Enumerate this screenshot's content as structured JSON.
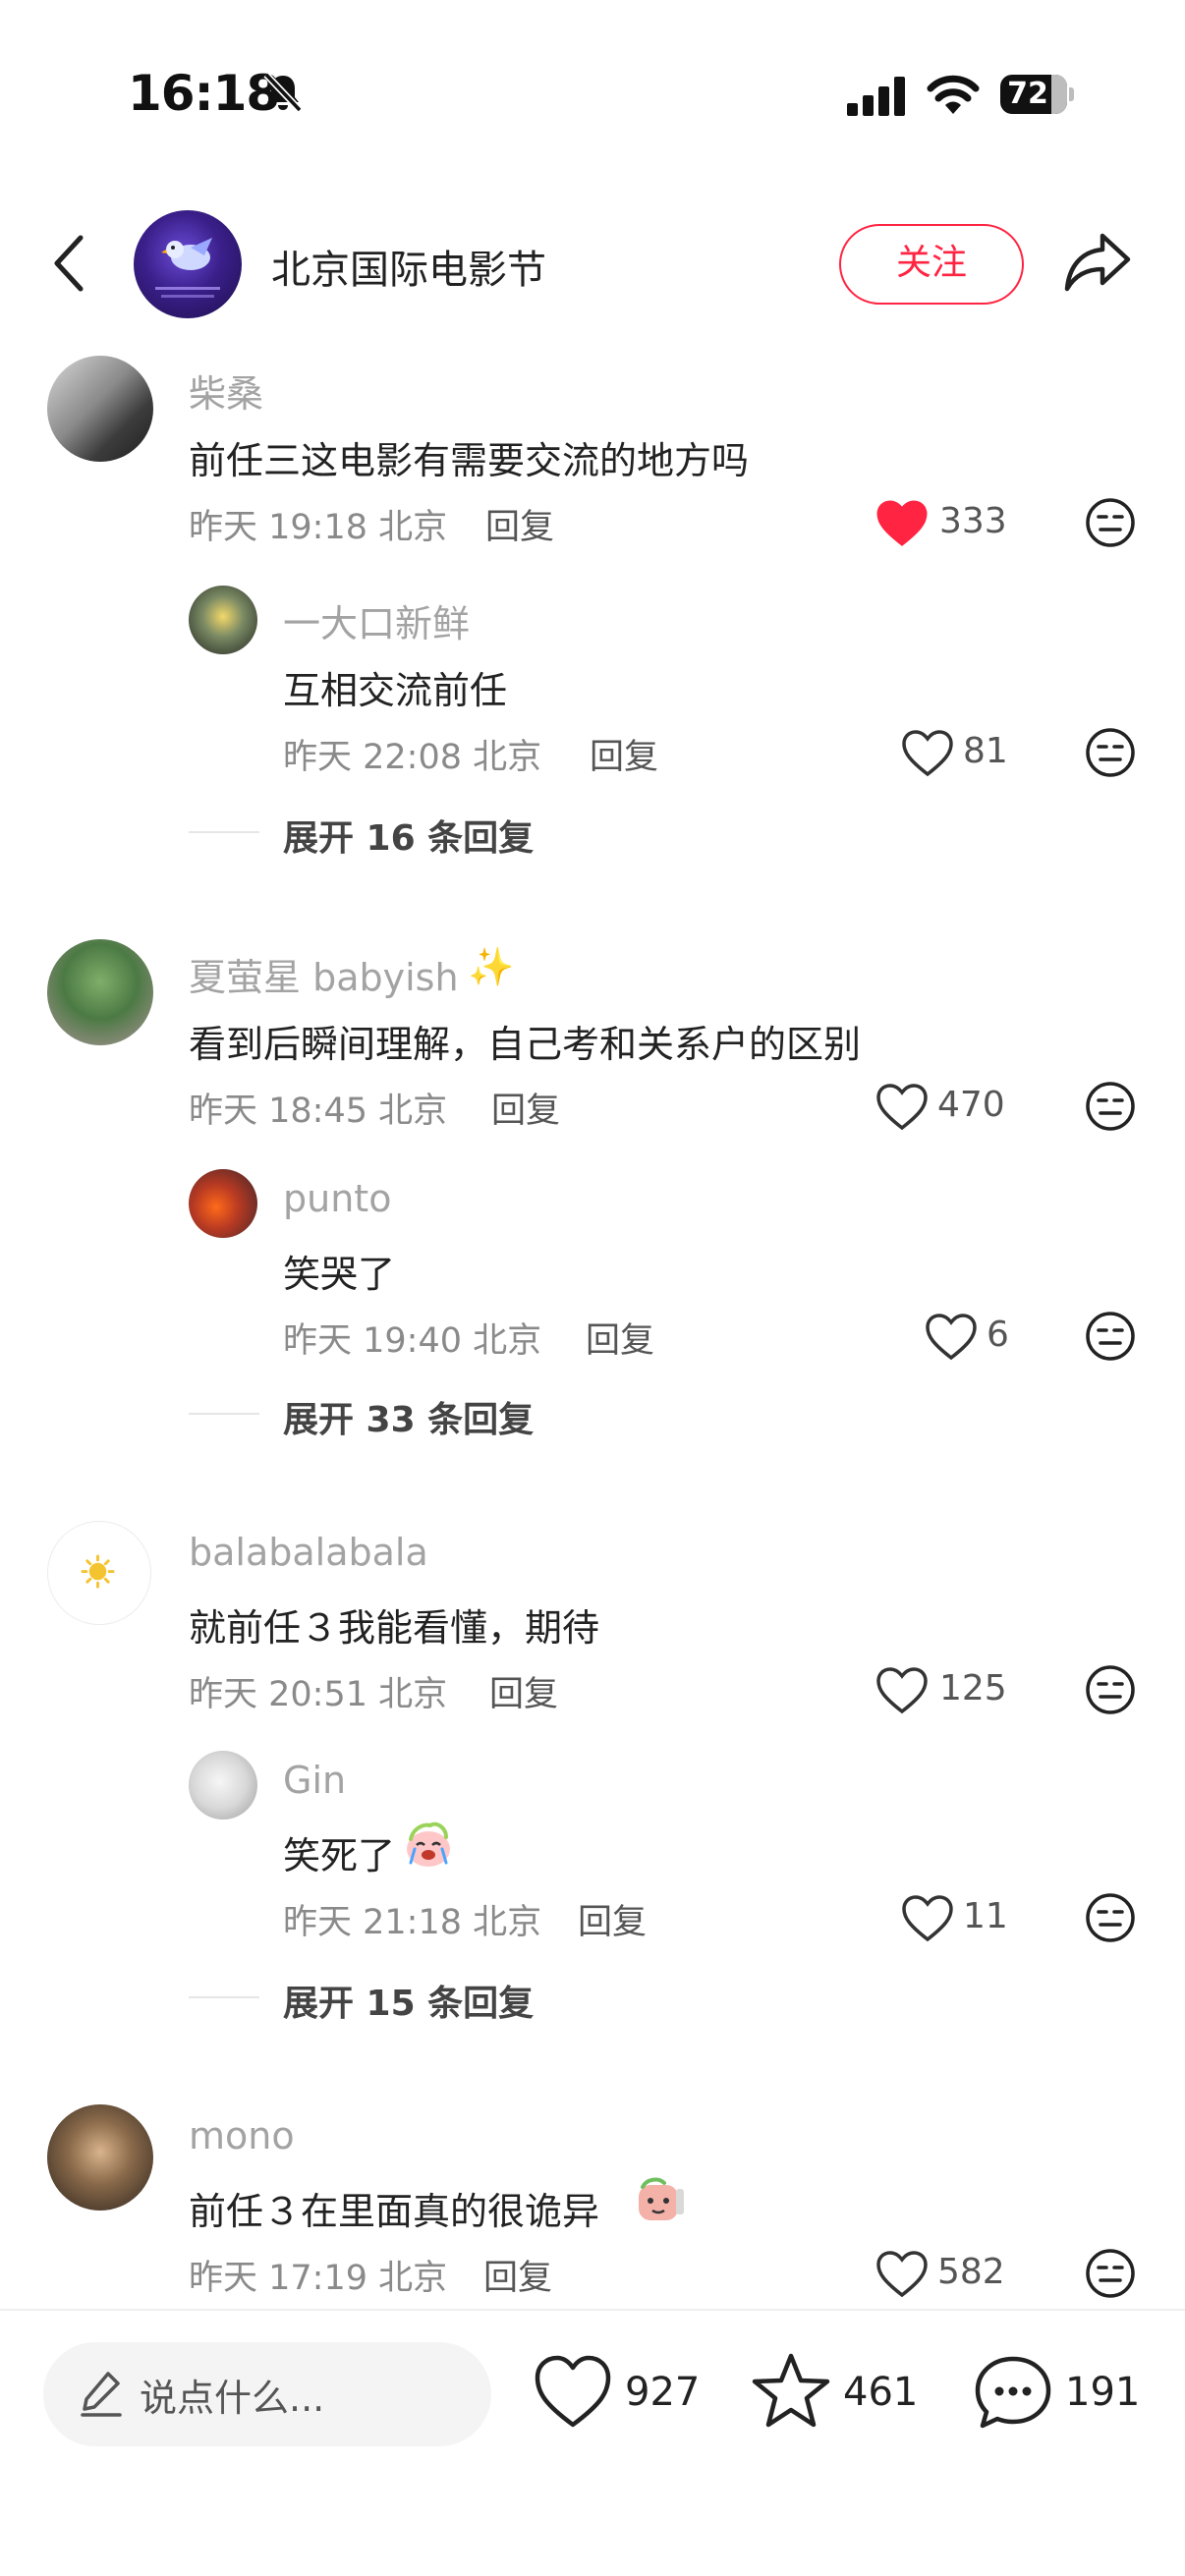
{
  "status_bar": {
    "time": "16:18",
    "battery": "72"
  },
  "header": {
    "account_name": "北京国际电影节",
    "follow_label": "关注"
  },
  "comments": [
    {
      "user": "柴桑",
      "text": "前任三这电影有需要交流的地方吗",
      "time": "昨天 19:18 北京",
      "reply_label": "回复",
      "likes": "333",
      "liked": true,
      "replies": [
        {
          "user": "一大口新鲜",
          "text": "互相交流前任",
          "time": "昨天 22:08 北京",
          "reply_label": "回复",
          "likes": "81"
        }
      ],
      "expand": "展开 16 条回复"
    },
    {
      "user": "夏萤星 babyish",
      "user_emoji": "✨",
      "text": "看到后瞬间理解，自己考和关系户的区别",
      "time": "昨天 18:45 北京",
      "reply_label": "回复",
      "likes": "470",
      "liked": false,
      "replies": [
        {
          "user": "punto",
          "text": "笑哭了",
          "time": "昨天 19:40 北京",
          "reply_label": "回复",
          "likes": "6"
        }
      ],
      "expand": "展开 33 条回复"
    },
    {
      "user": "balabalabala",
      "text": "就前任３我能看懂，期待",
      "time": "昨天 20:51 北京",
      "reply_label": "回复",
      "likes": "125",
      "liked": false,
      "replies": [
        {
          "user": "Gin",
          "text": "笑死了",
          "time": "昨天 21:18 北京",
          "reply_label": "回复",
          "likes": "11"
        }
      ],
      "expand": "展开 15 条回复"
    },
    {
      "user": "mono",
      "text": "前任３在里面真的很诡异",
      "time": "昨天 17:19 北京",
      "reply_label": "回复",
      "likes": "582",
      "liked": false
    }
  ],
  "bottom_bar": {
    "input_placeholder": "说点什么...",
    "like_count": "927",
    "star_count": "461",
    "comment_count": "191"
  },
  "colors": {
    "accent": "#ff2442",
    "like_red": "#ff2442",
    "text": "#222222",
    "muted": "#a3a3a3"
  },
  "icons": [
    "back-icon",
    "share-icon",
    "heart-icon",
    "neutral-face-icon",
    "pencil-icon",
    "star-icon",
    "comment-icon",
    "bell-slash-icon",
    "signal-icon",
    "wifi-icon",
    "battery-icon"
  ]
}
